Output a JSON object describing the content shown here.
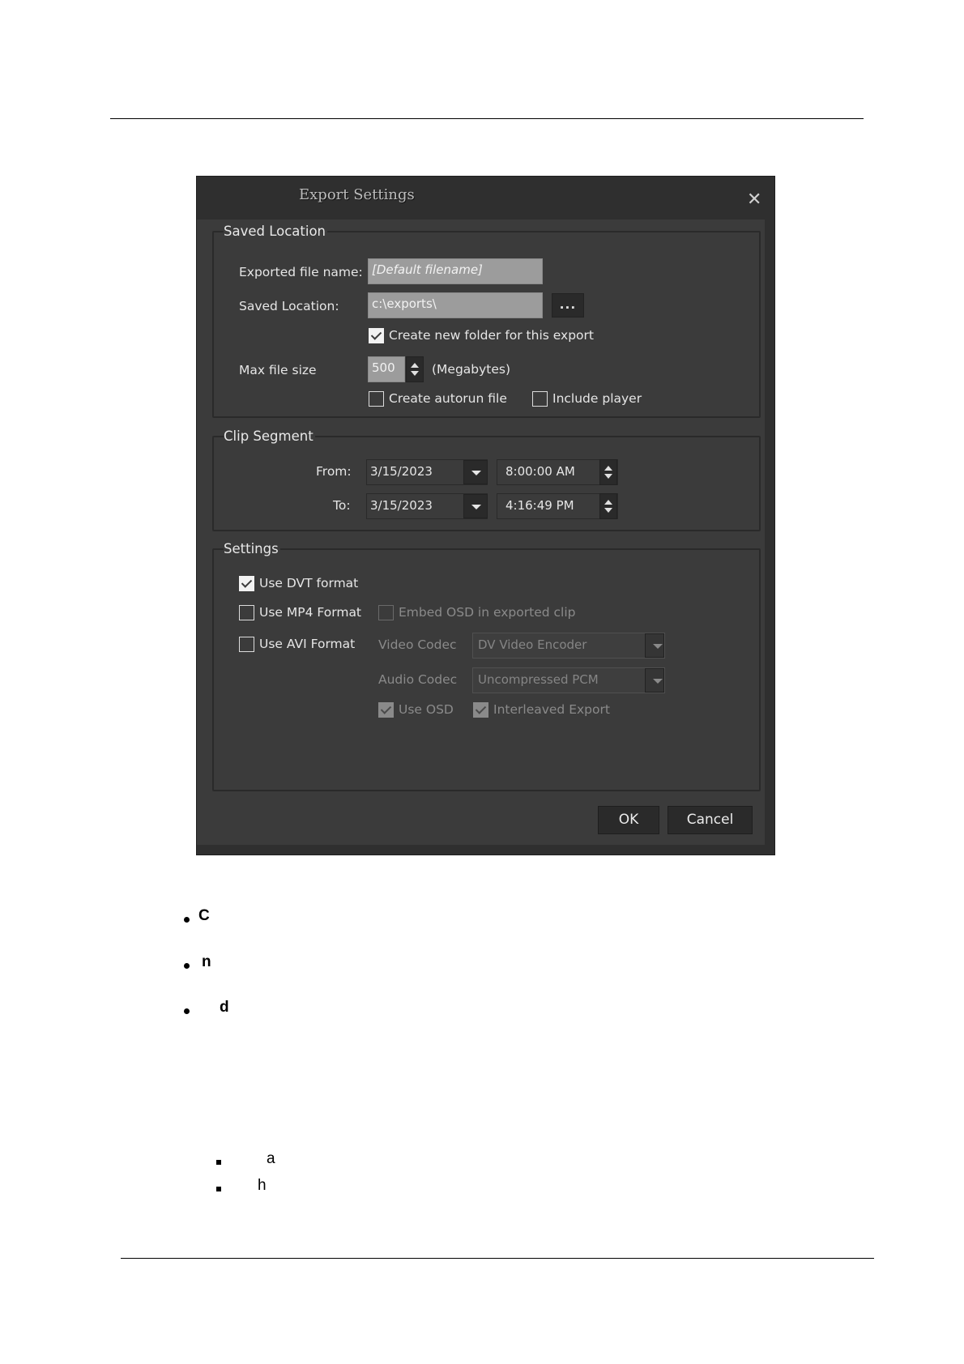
{
  "dialog": {
    "title": "Export Settings",
    "close_icon": "close-icon",
    "saved_location": {
      "legend": "Saved Location",
      "file_name_label": "Exported file name:",
      "file_name_value": "[Default filename]",
      "location_label": "Saved Location:",
      "location_value": "c:\\exports\\",
      "browse_label": "...",
      "create_folder_label": "Create new folder for this export",
      "create_folder_checked": true,
      "max_size_label": "Max file size",
      "max_size_value": "500",
      "max_size_unit": "(Megabytes)",
      "autorun_label": "Create autorun file",
      "autorun_checked": false,
      "include_player_label": "Include player",
      "include_player_checked": false
    },
    "clip_segment": {
      "legend": "Clip Segment",
      "from_label": "From:",
      "from_date": "3/15/2023",
      "from_time": "8:00:00 AM",
      "to_label": "To:",
      "to_date": "3/15/2023",
      "to_time": "4:16:49 PM"
    },
    "settings": {
      "legend": "Settings",
      "dvt_label": "Use DVT format",
      "dvt_checked": true,
      "mp4_label": "Use MP4 Format",
      "mp4_checked": false,
      "embed_osd_label": "Embed OSD in exported clip",
      "avi_label": "Use AVI Format",
      "avi_checked": false,
      "video_codec_label": "Video Codec",
      "video_codec_value": "DV Video Encoder",
      "audio_codec_label": "Audio Codec",
      "audio_codec_value": "Uncompressed PCM",
      "use_osd_label": "Use OSD",
      "interleaved_label": "Interleaved Export"
    },
    "ok_label": "OK",
    "cancel_label": "Cancel"
  },
  "bullets": [
    {
      "text": "C"
    },
    {
      "text": "n"
    },
    {
      "text": "d"
    }
  ],
  "sub_bullets": [
    {
      "text": "a"
    },
    {
      "text": "h"
    }
  ]
}
